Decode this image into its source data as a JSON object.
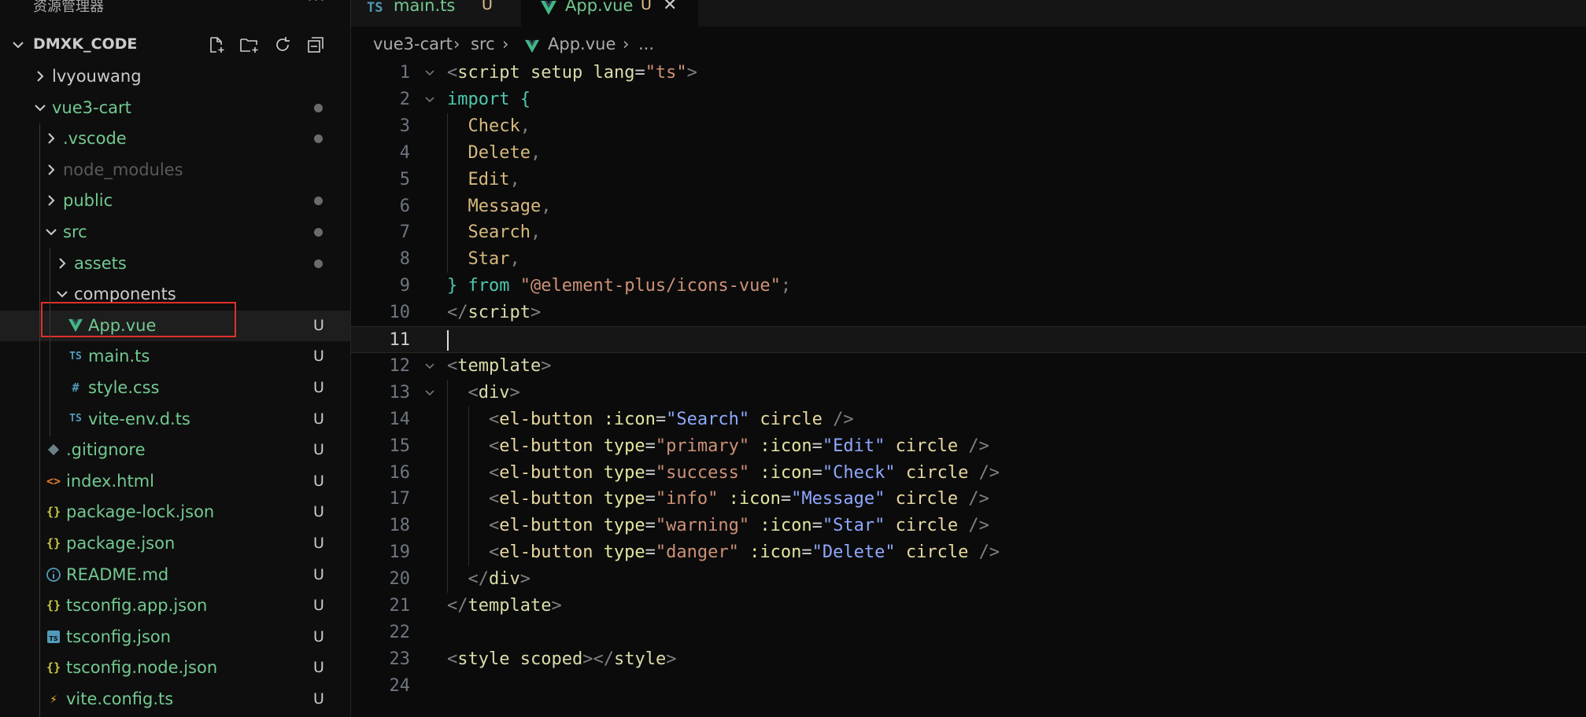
{
  "sidebar": {
    "title": "资源管理器",
    "more": "···",
    "section_title": "DMXK_CODE",
    "tree": [
      {
        "label": "lvyouwang",
        "kind": "folder",
        "expanded": false,
        "status": "",
        "color": "#cccccc"
      },
      {
        "label": "vue3-cart",
        "kind": "folder",
        "expanded": true,
        "status": "dot",
        "color": "#73c991"
      },
      {
        "label": ".vscode",
        "kind": "folder",
        "expanded": false,
        "status": "dot",
        "color": "#73c991"
      },
      {
        "label": "node_modules",
        "kind": "folder",
        "expanded": false,
        "status": "",
        "color": "#5a5a5a"
      },
      {
        "label": "public",
        "kind": "folder",
        "expanded": false,
        "status": "dot",
        "color": "#73c991"
      },
      {
        "label": "src",
        "kind": "folder",
        "expanded": true,
        "status": "dot",
        "color": "#73c991"
      },
      {
        "label": "assets",
        "kind": "folder",
        "expanded": false,
        "status": "dot",
        "color": "#73c991"
      },
      {
        "label": "components",
        "kind": "folder",
        "expanded": true,
        "status": "",
        "color": "#cccccc"
      },
      {
        "label": "App.vue",
        "kind": "vue",
        "icon_text": "V",
        "status": "U",
        "color": "#73c991"
      },
      {
        "label": "main.ts",
        "kind": "ts",
        "icon_text": "TS",
        "status": "U",
        "color": "#73c991"
      },
      {
        "label": "style.css",
        "kind": "css",
        "icon_text": "#",
        "status": "U",
        "color": "#73c991"
      },
      {
        "label": "vite-env.d.ts",
        "kind": "ts",
        "icon_text": "TS",
        "status": "U",
        "color": "#73c991"
      },
      {
        "label": ".gitignore",
        "kind": "git",
        "icon_text": "◆",
        "status": "U",
        "color": "#73c991"
      },
      {
        "label": "index.html",
        "kind": "html",
        "icon_text": "<>",
        "status": "U",
        "color": "#73c991"
      },
      {
        "label": "package-lock.json",
        "kind": "json",
        "icon_text": "{}",
        "status": "U",
        "color": "#73c991"
      },
      {
        "label": "package.json",
        "kind": "json",
        "icon_text": "{}",
        "status": "U",
        "color": "#73c991"
      },
      {
        "label": "README.md",
        "kind": "info",
        "icon_text": "i",
        "status": "U",
        "color": "#73c991"
      },
      {
        "label": "tsconfig.app.json",
        "kind": "json",
        "icon_text": "{}",
        "status": "U",
        "color": "#73c991"
      },
      {
        "label": "tsconfig.json",
        "kind": "tsconfig",
        "icon_text": "TS",
        "status": "U",
        "color": "#73c991"
      },
      {
        "label": "tsconfig.node.json",
        "kind": "json",
        "icon_text": "{}",
        "status": "U",
        "color": "#73c991"
      },
      {
        "label": "vite.config.ts",
        "kind": "vite",
        "icon_text": "⚡",
        "status": "U",
        "color": "#73c991"
      }
    ]
  },
  "tabs": [
    {
      "icon": "TS",
      "label": "main.ts",
      "status": "U",
      "active": false
    },
    {
      "icon": "V",
      "label": "App.vue",
      "status": "U",
      "close": "✕",
      "active": true
    }
  ],
  "breadcrumb": {
    "part1": "vue3-cart",
    "part2": "src",
    "part3": "App.vue",
    "part4": "...",
    "sep": "›"
  },
  "editor": {
    "current_line": 11,
    "lines": [
      [
        [
          "<",
          "punc"
        ],
        [
          "script ",
          "tag"
        ],
        [
          "setup ",
          "attr"
        ],
        [
          "lang",
          "attr"
        ],
        [
          "=",
          "eq"
        ],
        [
          "\"ts\"",
          "str"
        ],
        [
          ">",
          "punc"
        ]
      ],
      [
        [
          "import ",
          "key"
        ],
        [
          "{",
          "key"
        ]
      ],
      [
        [
          "  Check",
          "id"
        ],
        [
          ",",
          "punc"
        ]
      ],
      [
        [
          "  Delete",
          "id"
        ],
        [
          ",",
          "punc"
        ]
      ],
      [
        [
          "  Edit",
          "id"
        ],
        [
          ",",
          "punc"
        ]
      ],
      [
        [
          "  Message",
          "id"
        ],
        [
          ",",
          "punc"
        ]
      ],
      [
        [
          "  Search",
          "id"
        ],
        [
          ",",
          "punc"
        ]
      ],
      [
        [
          "  Star",
          "id"
        ],
        [
          ",",
          "punc"
        ]
      ],
      [
        [
          "} ",
          "key"
        ],
        [
          "from ",
          "key"
        ],
        [
          "\"",
          "str"
        ],
        [
          "@element-plus/icons-vue",
          "str"
        ],
        [
          "\"",
          "str"
        ],
        [
          ";",
          "punc"
        ]
      ],
      [
        [
          "</",
          "punc"
        ],
        [
          "script",
          "tag"
        ],
        [
          ">",
          "punc"
        ]
      ],
      [],
      [
        [
          "<",
          "punc"
        ],
        [
          "template",
          "tag"
        ],
        [
          ">",
          "punc"
        ]
      ],
      [
        [
          "  <",
          "punc"
        ],
        [
          "div",
          "tag"
        ],
        [
          ">",
          "punc"
        ]
      ],
      [
        [
          "    <",
          "punc"
        ],
        [
          "el-button ",
          "comp"
        ],
        [
          ":icon",
          "bind"
        ],
        [
          "=",
          "eq"
        ],
        [
          "\"Search\"",
          "val"
        ],
        [
          " circle ",
          "comp"
        ],
        [
          "/>",
          "punc"
        ]
      ],
      [
        [
          "    <",
          "punc"
        ],
        [
          "el-button ",
          "comp"
        ],
        [
          "type",
          "bind"
        ],
        [
          "=",
          "eq"
        ],
        [
          "\"primary\"",
          "str"
        ],
        [
          " :icon",
          "bind"
        ],
        [
          "=",
          "eq"
        ],
        [
          "\"Edit\"",
          "val"
        ],
        [
          " circle ",
          "comp"
        ],
        [
          "/>",
          "punc"
        ]
      ],
      [
        [
          "    <",
          "punc"
        ],
        [
          "el-button ",
          "comp"
        ],
        [
          "type",
          "bind"
        ],
        [
          "=",
          "eq"
        ],
        [
          "\"success\"",
          "str"
        ],
        [
          " :icon",
          "bind"
        ],
        [
          "=",
          "eq"
        ],
        [
          "\"Check\"",
          "val"
        ],
        [
          " circle ",
          "comp"
        ],
        [
          "/>",
          "punc"
        ]
      ],
      [
        [
          "    <",
          "punc"
        ],
        [
          "el-button ",
          "comp"
        ],
        [
          "type",
          "bind"
        ],
        [
          "=",
          "eq"
        ],
        [
          "\"info\"",
          "str"
        ],
        [
          " :icon",
          "bind"
        ],
        [
          "=",
          "eq"
        ],
        [
          "\"Message\"",
          "val"
        ],
        [
          " circle ",
          "comp"
        ],
        [
          "/>",
          "punc"
        ]
      ],
      [
        [
          "    <",
          "punc"
        ],
        [
          "el-button ",
          "comp"
        ],
        [
          "type",
          "bind"
        ],
        [
          "=",
          "eq"
        ],
        [
          "\"warning\"",
          "str"
        ],
        [
          " :icon",
          "bind"
        ],
        [
          "=",
          "eq"
        ],
        [
          "\"Star\"",
          "val"
        ],
        [
          " circle ",
          "comp"
        ],
        [
          "/>",
          "punc"
        ]
      ],
      [
        [
          "    <",
          "punc"
        ],
        [
          "el-button ",
          "comp"
        ],
        [
          "type",
          "bind"
        ],
        [
          "=",
          "eq"
        ],
        [
          "\"danger\"",
          "str"
        ],
        [
          " :icon",
          "bind"
        ],
        [
          "=",
          "eq"
        ],
        [
          "\"Delete\"",
          "val"
        ],
        [
          " circle ",
          "comp"
        ],
        [
          "/>",
          "punc"
        ]
      ],
      [
        [
          "  </",
          "punc"
        ],
        [
          "div",
          "tag"
        ],
        [
          ">",
          "punc"
        ]
      ],
      [
        [
          "</",
          "punc"
        ],
        [
          "template",
          "tag"
        ],
        [
          ">",
          "punc"
        ]
      ],
      [],
      [
        [
          "<",
          "punc"
        ],
        [
          "style ",
          "tag"
        ],
        [
          "scoped",
          "attr"
        ],
        [
          "></",
          "punc"
        ],
        [
          "style",
          "tag"
        ],
        [
          ">",
          "punc"
        ]
      ],
      []
    ],
    "folds": [
      1,
      2,
      12,
      13
    ]
  },
  "colors": {
    "vue": "#41b883",
    "ts": "#519aba",
    "css": "#519aba",
    "json": "#cbcb41",
    "html": "#e37933",
    "git": "#6d8086",
    "info": "#519aba",
    "vite": "#ffc517",
    "highlight": "#e0302a"
  }
}
